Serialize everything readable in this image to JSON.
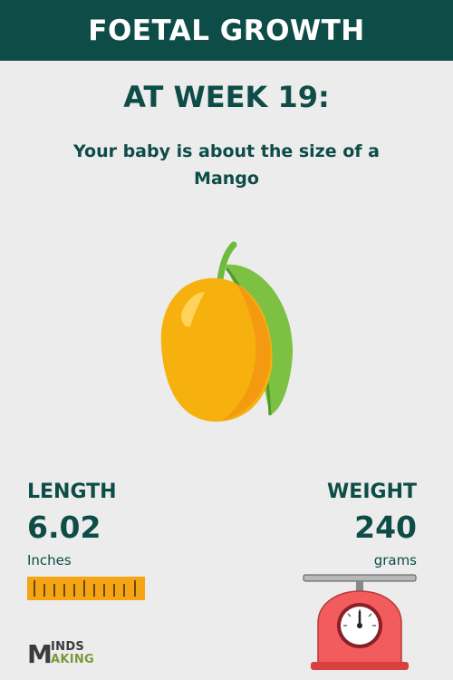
{
  "header": {
    "title": "FOETAL GROWTH"
  },
  "week": {
    "heading": "AT WEEK 19:"
  },
  "comparison": {
    "text": "Your baby is about the size of a Mango",
    "fruit_icon": "mango-icon"
  },
  "length": {
    "label": "LENGTH",
    "value": "6.02",
    "unit": "Inches",
    "icon": "ruler-icon"
  },
  "weight": {
    "label": "WEIGHT",
    "value": "240",
    "unit": "grams",
    "icon": "scale-icon"
  },
  "logo": {
    "text_top": "INDS",
    "text_bottom": "AKING",
    "initial": "M"
  },
  "colors": {
    "header_bg": "#0e4c47",
    "text_primary": "#0e4c47",
    "background": "#ececec",
    "ruler": "#f5a514",
    "scale": "#f25c5c"
  }
}
